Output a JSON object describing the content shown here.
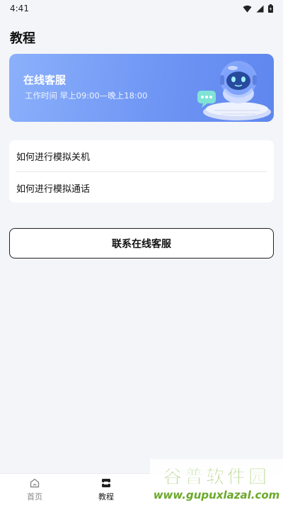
{
  "status_bar": {
    "time": "4:41"
  },
  "page": {
    "title": "教程"
  },
  "banner": {
    "title": "在线客服",
    "hours": "工作时间 早上09:00—晚上18:00"
  },
  "faq": {
    "items": [
      {
        "label": "如何进行模拟关机"
      },
      {
        "label": "如何进行模拟通话"
      }
    ]
  },
  "contact_button": {
    "label": "联系在线客服"
  },
  "tabbar": {
    "tabs": [
      {
        "label": "首页",
        "icon": "home-icon",
        "active": false
      },
      {
        "label": "教程",
        "icon": "tutorial-icon",
        "active": true
      }
    ]
  },
  "watermark": {
    "brand": "谷普软件园",
    "url": "www.gupuxlazal.com"
  },
  "colors": {
    "background": "#f4f5f9",
    "banner_start": "#8bb0fb",
    "banner_end": "#5f86ee",
    "watermark_green": "#7ab532"
  }
}
